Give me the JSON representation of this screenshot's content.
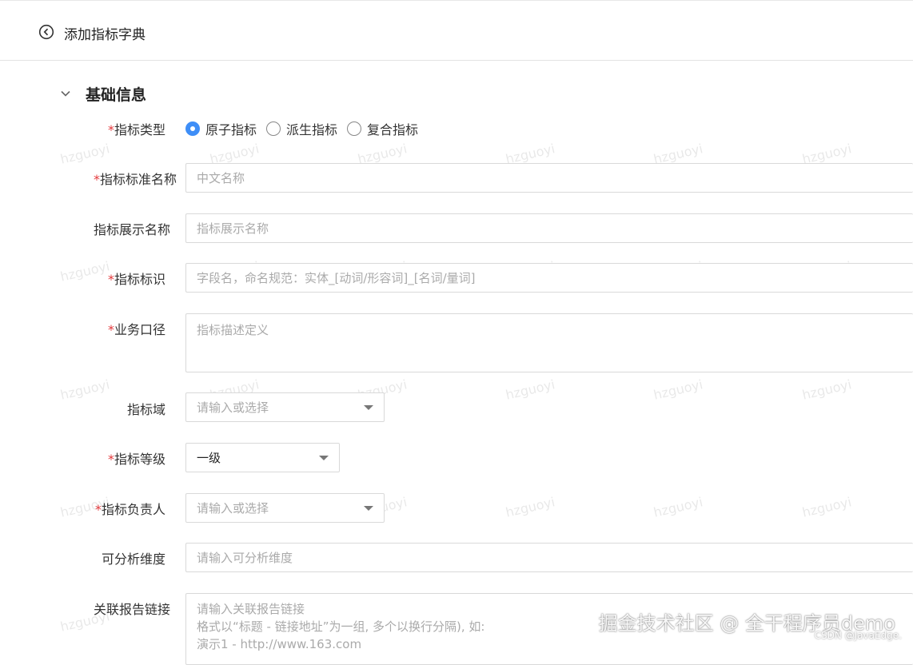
{
  "header": {
    "title": "添加指标字典",
    "back_icon": "arrow-left-circle-icon"
  },
  "section": {
    "title": "基础信息",
    "collapse_icon": "chevron-down-icon"
  },
  "form": {
    "metric_type": {
      "label": "指标类型",
      "required": "*",
      "options": [
        {
          "label": "原子指标",
          "checked": true
        },
        {
          "label": "派生指标",
          "checked": false
        },
        {
          "label": "复合指标",
          "checked": false
        }
      ]
    },
    "std_name": {
      "label": "指标标准名称",
      "required": "*",
      "placeholder": "中文名称"
    },
    "display_name": {
      "label": "指标展示名称",
      "placeholder": "指标展示名称"
    },
    "identifier": {
      "label": "指标标识",
      "required": "*",
      "placeholder": "字段名，命名规范：实体_[动词/形容词]_[名词/量词]"
    },
    "business_caliber": {
      "label": "业务口径",
      "required": "*",
      "placeholder": "指标描述定义"
    },
    "domain": {
      "label": "指标域",
      "placeholder": "请输入或选择"
    },
    "level": {
      "label": "指标等级",
      "required": "*",
      "value": "一级"
    },
    "owner": {
      "label": "指标负责人",
      "required": "*",
      "placeholder": "请输入或选择"
    },
    "dimensions": {
      "label": "可分析维度",
      "placeholder": "请输入可分析维度"
    },
    "report_links": {
      "label": "关联报告链接",
      "placeholder_lines": [
        "请输入关联报告链接",
        "格式以“标题 - 链接地址”为一组, 多个以换行分隔), 如:",
        "演示1 - http://www.163.com"
      ]
    }
  },
  "watermark": {
    "text": "hzguoyi"
  },
  "footer": {
    "brand": "掘金技术社区 @ 全干程序员demo",
    "source": "CSDN @JavaEdge."
  },
  "colors": {
    "accent": "#3e8ef7",
    "required": "#e4393c",
    "border": "#d9d9d9"
  }
}
